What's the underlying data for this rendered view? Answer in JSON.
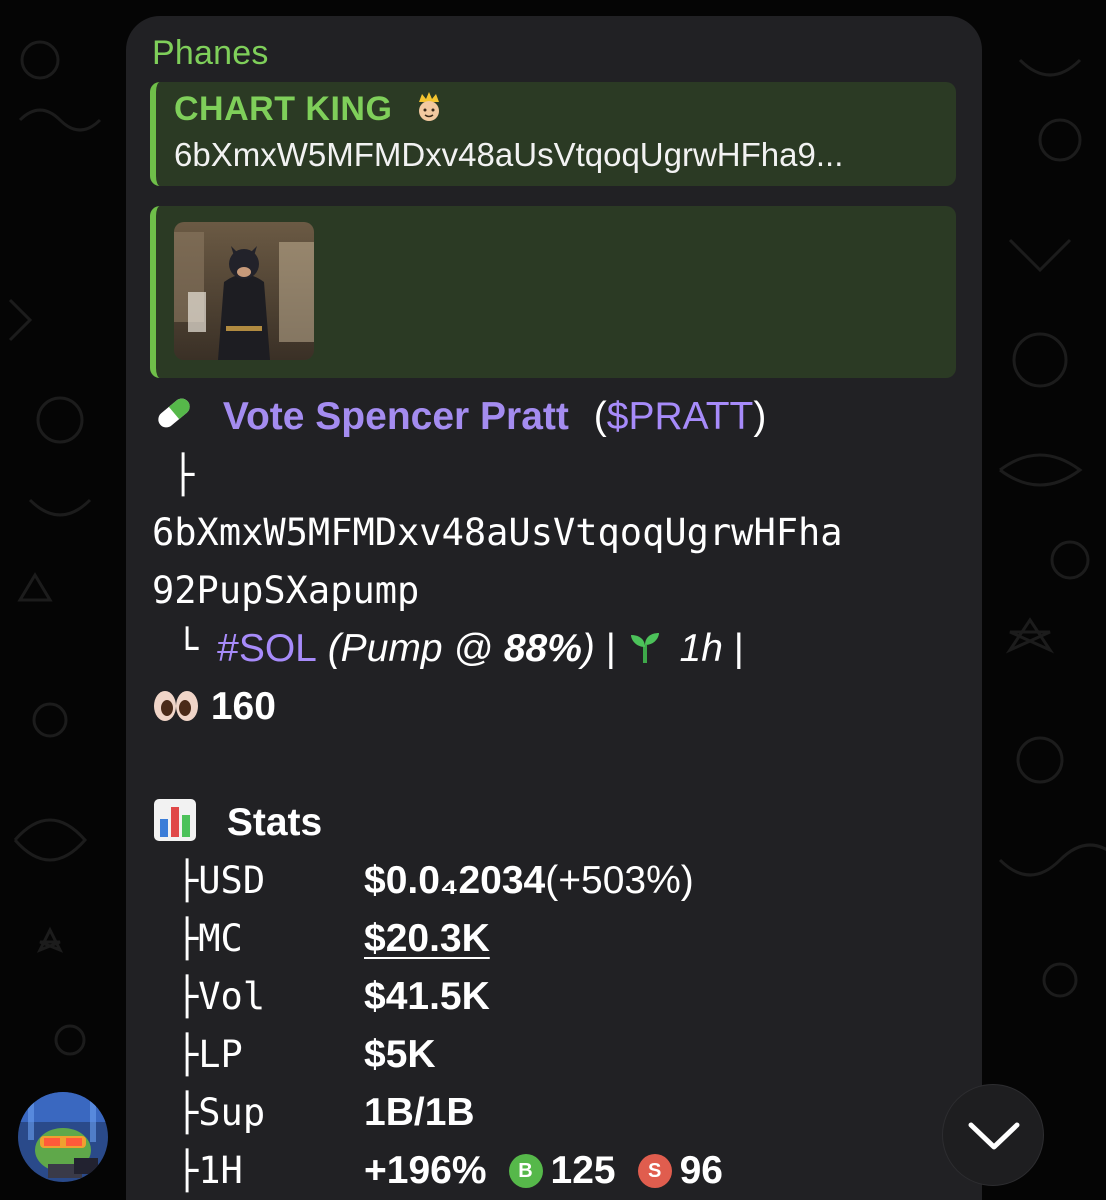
{
  "message": {
    "sender": "Phanes",
    "reply": {
      "title": "CHART KING",
      "title_emoji": "prince-emoji",
      "text": "6bXmxW5MFMDxv48aUsVtqoqUgrwHFha9..."
    },
    "token": {
      "emoji": "pill-emoji",
      "name": "Vote Spencer Pratt",
      "paren_open": "(",
      "ticker": "$PRATT",
      "paren_close": ")",
      "tree_branch": "├",
      "address_line1": "6bXmxW5MFMDxv48aUsVtqoqUgrwHFha",
      "address_line2": "92PupSXapump",
      "tree_end": "└",
      "chain": "#SOL",
      "pump_prefix": " (Pump @ ",
      "pump_pct": "88%",
      "pump_suffix": ")",
      "sep1": " | ",
      "age": "1h",
      "sep2": " |",
      "age_emoji": "seedling-emoji",
      "views_emoji": "eyes-emoji",
      "views": "160"
    },
    "stats": {
      "emoji": "bar-chart-emoji",
      "title": "Stats",
      "rows": [
        {
          "key": "├USD",
          "value": "$0.0₄2034",
          "extra": " (+503%)"
        },
        {
          "key": "├MC",
          "value": "$20.3K"
        },
        {
          "key": "├Vol",
          "value": "$41.5K"
        },
        {
          "key": "├LP",
          "value": "$5K"
        },
        {
          "key": "├Sup",
          "value": "1B/1B"
        },
        {
          "key": "├1H",
          "value": "+196%",
          "buys": "125",
          "sells": "96",
          "buy_badge": "B",
          "sell_badge": "S"
        }
      ]
    }
  },
  "colors": {
    "background": "#050505",
    "bubble": "#212124",
    "sender_green": "#7fcf5a",
    "reply_bg": "#2b3a24",
    "accent_purple": "#a78bfa",
    "buy_green": "#56b84a",
    "sell_red": "#e05d4e"
  },
  "icons": {
    "scroll_down": "chevron-down-icon",
    "avatar": "pepe-avatar"
  }
}
